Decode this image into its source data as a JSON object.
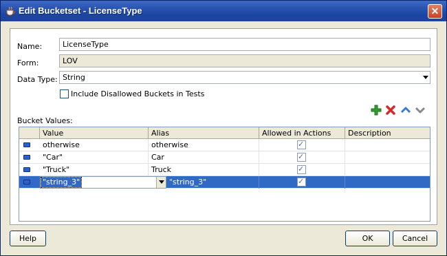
{
  "window": {
    "title": "Edit Bucketset - LicenseType",
    "close_symbol": "✕"
  },
  "form": {
    "name_label": "Name:",
    "name_value": "LicenseType",
    "form_label": "Form:",
    "form_value": "LOV",
    "datatype_label": "Data Type:",
    "datatype_value": "String",
    "include_disallowed_label": "Include Disallowed Buckets in Tests",
    "include_disallowed_checked": false,
    "bucket_values_label": "Bucket Values:"
  },
  "toolbar": {
    "icons": [
      "add-icon",
      "delete-icon",
      "move-up-icon",
      "move-down-icon"
    ],
    "colors": {
      "add": "#2fa02f",
      "delete": "#d42a2a",
      "move_up": "#3b7ad8",
      "move_down": "#8a8a8a"
    }
  },
  "grid": {
    "columns": [
      "Value",
      "Alias",
      "Allowed in Actions",
      "Description"
    ],
    "rows": [
      {
        "value": "otherwise",
        "alias": "otherwise",
        "allowed": true,
        "description": ""
      },
      {
        "value": "\"Car\"",
        "alias": "Car",
        "allowed": true,
        "description": ""
      },
      {
        "value": "\"Truck\"",
        "alias": "Truck",
        "allowed": true,
        "description": ""
      },
      {
        "value": "\"string_3\"",
        "alias": "\"string_3\"",
        "allowed": true,
        "description": ""
      }
    ],
    "selected_row": 3,
    "selection_color": "#316ac5"
  },
  "buttons": {
    "help": "Help",
    "ok": "OK",
    "cancel": "Cancel"
  }
}
